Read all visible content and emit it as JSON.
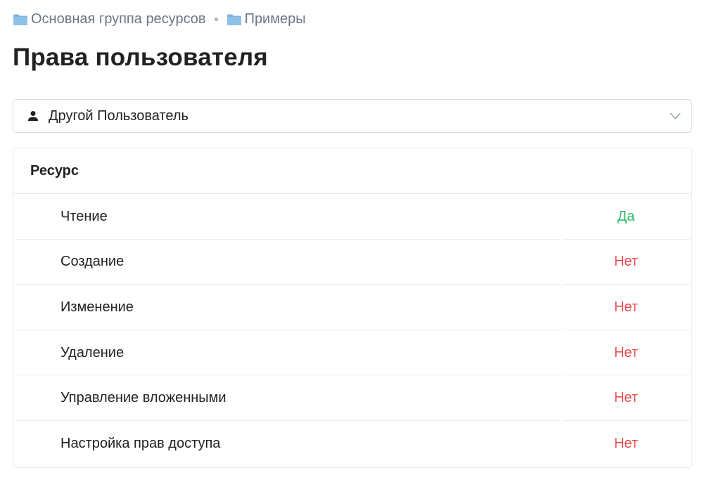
{
  "breadcrumb": {
    "items": [
      {
        "label": "Основная группа ресурсов",
        "icon": "folder-icon"
      },
      {
        "label": "Примеры",
        "icon": "folder-icon"
      }
    ]
  },
  "page": {
    "title": "Права пользователя"
  },
  "user_select": {
    "icon": "user-icon",
    "selected": "Другой Пользователь",
    "chevron": "chevron-down-icon"
  },
  "table": {
    "header": "Ресурс",
    "rows": [
      {
        "name": "Чтение",
        "value": "Да",
        "status": "yes"
      },
      {
        "name": "Создание",
        "value": "Нет",
        "status": "no"
      },
      {
        "name": "Изменение",
        "value": "Нет",
        "status": "no"
      },
      {
        "name": "Удаление",
        "value": "Нет",
        "status": "no"
      },
      {
        "name": "Управление вложенными",
        "value": "Нет",
        "status": "no"
      },
      {
        "name": "Настройка прав доступа",
        "value": "Нет",
        "status": "no"
      }
    ]
  },
  "colors": {
    "yes": "#2dbd6e",
    "no": "#e84545",
    "folder": "#7eb3e0",
    "muted_text": "#6b7785"
  }
}
